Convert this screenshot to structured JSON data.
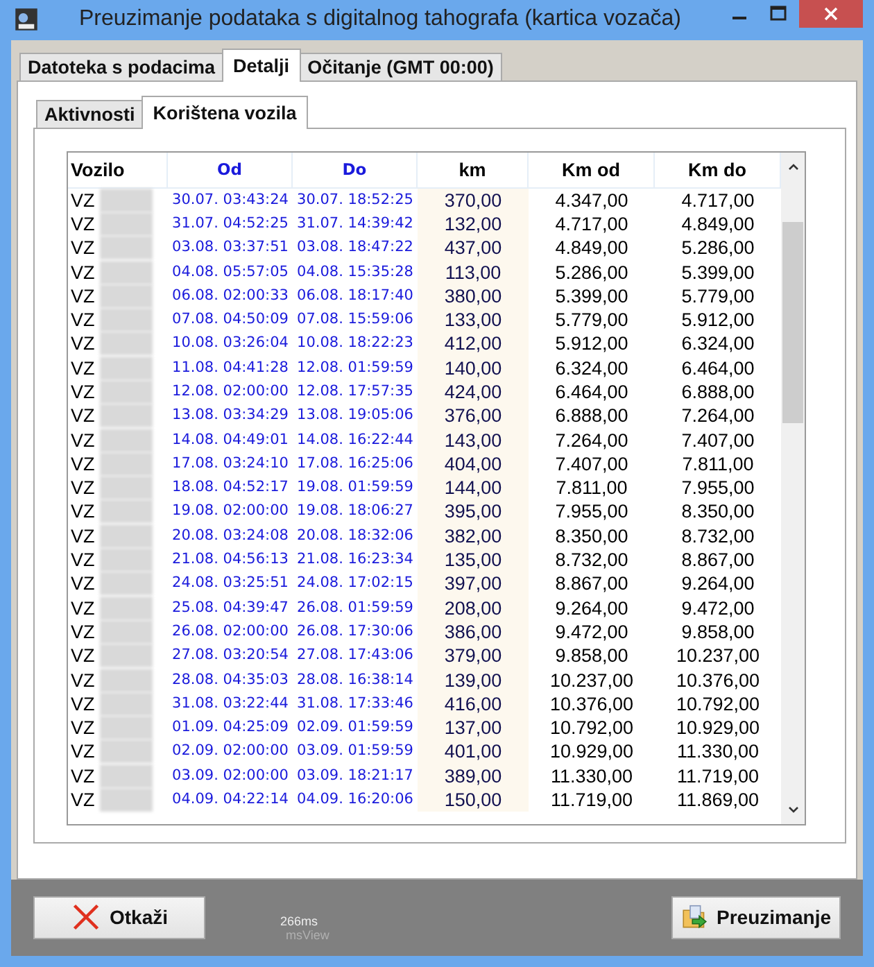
{
  "window": {
    "title": "Preuzimanje podataka s digitalnog tahografa (kartica vozača)"
  },
  "tabs": [
    {
      "label": "Datoteka s podacima",
      "selected": false
    },
    {
      "label": "Detalji",
      "selected": true
    },
    {
      "label": "Očitanje (GMT 00:00)",
      "selected": false
    }
  ],
  "subtabs": [
    {
      "label": "Aktivnosti",
      "selected": false
    },
    {
      "label": "Korištena vozila",
      "selected": true
    }
  ],
  "table": {
    "columns": [
      "Vozilo",
      "Od",
      "Do",
      "km",
      "Km od",
      "Km do"
    ],
    "rows": [
      [
        "VZ",
        "30.07. 03:43:24",
        "30.07. 18:52:25",
        "370,00",
        "4.347,00",
        "4.717,00"
      ],
      [
        "VZ",
        "31.07. 04:52:25",
        "31.07. 14:39:42",
        "132,00",
        "4.717,00",
        "4.849,00"
      ],
      [
        "VZ",
        "03.08. 03:37:51",
        "03.08. 18:47:22",
        "437,00",
        "4.849,00",
        "5.286,00"
      ],
      [
        "VZ",
        "04.08. 05:57:05",
        "04.08. 15:35:28",
        "113,00",
        "5.286,00",
        "5.399,00"
      ],
      [
        "VZ",
        "06.08. 02:00:33",
        "06.08. 18:17:40",
        "380,00",
        "5.399,00",
        "5.779,00"
      ],
      [
        "VZ",
        "07.08. 04:50:09",
        "07.08. 15:59:06",
        "133,00",
        "5.779,00",
        "5.912,00"
      ],
      [
        "VZ",
        "10.08. 03:26:04",
        "10.08. 18:22:23",
        "412,00",
        "5.912,00",
        "6.324,00"
      ],
      [
        "VZ",
        "11.08. 04:41:28",
        "12.08. 01:59:59",
        "140,00",
        "6.324,00",
        "6.464,00"
      ],
      [
        "VZ",
        "12.08. 02:00:00",
        "12.08. 17:57:35",
        "424,00",
        "6.464,00",
        "6.888,00"
      ],
      [
        "VZ",
        "13.08. 03:34:29",
        "13.08. 19:05:06",
        "376,00",
        "6.888,00",
        "7.264,00"
      ],
      [
        "VZ",
        "14.08. 04:49:01",
        "14.08. 16:22:44",
        "143,00",
        "7.264,00",
        "7.407,00"
      ],
      [
        "VZ",
        "17.08. 03:24:10",
        "17.08. 16:25:06",
        "404,00",
        "7.407,00",
        "7.811,00"
      ],
      [
        "VZ",
        "18.08. 04:52:17",
        "19.08. 01:59:59",
        "144,00",
        "7.811,00",
        "7.955,00"
      ],
      [
        "VZ",
        "19.08. 02:00:00",
        "19.08. 18:06:27",
        "395,00",
        "7.955,00",
        "8.350,00"
      ],
      [
        "VZ",
        "20.08. 03:24:08",
        "20.08. 18:32:06",
        "382,00",
        "8.350,00",
        "8.732,00"
      ],
      [
        "VZ",
        "21.08. 04:56:13",
        "21.08. 16:23:34",
        "135,00",
        "8.732,00",
        "8.867,00"
      ],
      [
        "VZ",
        "24.08. 03:25:51",
        "24.08. 17:02:15",
        "397,00",
        "8.867,00",
        "9.264,00"
      ],
      [
        "VZ",
        "25.08. 04:39:47",
        "26.08. 01:59:59",
        "208,00",
        "9.264,00",
        "9.472,00"
      ],
      [
        "VZ",
        "26.08. 02:00:00",
        "26.08. 17:30:06",
        "386,00",
        "9.472,00",
        "9.858,00"
      ],
      [
        "VZ",
        "27.08. 03:20:54",
        "27.08. 17:43:06",
        "379,00",
        "9.858,00",
        "10.237,00"
      ],
      [
        "VZ",
        "28.08. 04:35:03",
        "28.08. 16:38:14",
        "139,00",
        "10.237,00",
        "10.376,00"
      ],
      [
        "VZ",
        "31.08. 03:22:44",
        "31.08. 17:33:46",
        "416,00",
        "10.376,00",
        "10.792,00"
      ],
      [
        "VZ",
        "01.09. 04:25:09",
        "02.09. 01:59:59",
        "137,00",
        "10.792,00",
        "10.929,00"
      ],
      [
        "VZ",
        "02.09. 02:00:00",
        "03.09. 01:59:59",
        "401,00",
        "10.929,00",
        "11.330,00"
      ],
      [
        "VZ",
        "03.09. 02:00:00",
        "03.09. 18:21:17",
        "389,00",
        "11.330,00",
        "11.719,00"
      ],
      [
        "VZ",
        "04.09. 04:22:14",
        "04.09. 16:20:06",
        "150,00",
        "11.719,00",
        "11.869,00"
      ]
    ]
  },
  "buttons": [
    {
      "label": "Otkaži",
      "kind": "cancel"
    },
    {
      "label": "Preuzimanje",
      "kind": "download"
    }
  ],
  "status": {
    "timing": "266ms",
    "view": "msView"
  }
}
